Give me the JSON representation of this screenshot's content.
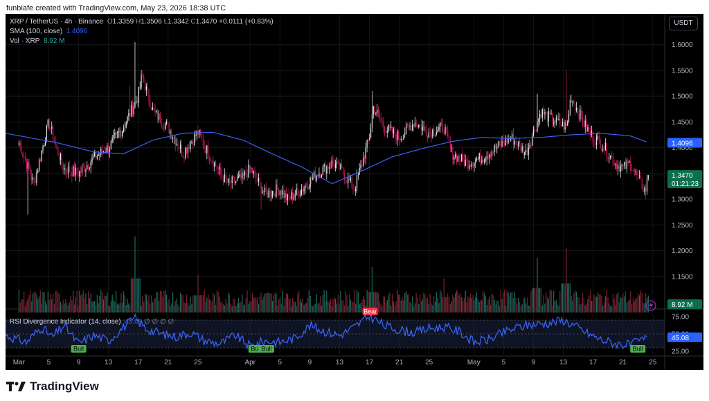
{
  "header": {
    "credit": "funbiafe created with TradingView.com, May 23, 2026 18:38 UTC"
  },
  "legend": {
    "symbol": "XRP / TetherUS · 4h · Binance",
    "o_label": "O",
    "o": "1.3359",
    "h_label": "H",
    "h": "1.3506",
    "l_label": "L",
    "l": "1.3342",
    "c_label": "C",
    "c": "1.3470",
    "change": "+0.0111 (+0.83%)",
    "sma_label": "SMA (100, close)",
    "sma_value": "1.4096",
    "vol_label": "Vol · XRP",
    "vol_value": "8.92 M",
    "rsi_label": "RSI Divergence Indicator (14, close)",
    "rsi_value": "45.08",
    "rsi_na": "∅ ∅ ∅ ∅"
  },
  "currency_button": "USDT",
  "price_badges": {
    "sma": "1.4096",
    "last": "1.3470",
    "countdown": "01:21:23",
    "volume": "8.92 M",
    "rsi": "45.08"
  },
  "footer": {
    "brand": "TradingView",
    "logo_icon": "tradingview-logo-icon"
  },
  "colors": {
    "up": "#e8e8e8",
    "down": "#c2185b",
    "sma": "#3962f5",
    "rsi": "#3962f5",
    "vol_up": "#1e6b5f",
    "vol_down": "#7a2330",
    "bull": "#4caf50",
    "bear": "#f23645",
    "badge_sma": "#2962ff",
    "badge_last": "#0b6e4f",
    "badge_vol": "#0b6e4f"
  },
  "chart_data": [
    {
      "type": "candlestick",
      "title": "XRP / TetherUS · 4h · Binance",
      "ylim": [
        1.08,
        1.66
      ],
      "y_ticks": [
        1.6,
        1.55,
        1.5,
        1.45,
        1.4,
        1.35,
        1.3,
        1.25,
        1.2,
        1.15
      ],
      "x_ticks": [
        "Mar",
        "5",
        "9",
        "13",
        "17",
        "21",
        "25",
        "Apr",
        "5",
        "9",
        "13",
        "17",
        "21",
        "25",
        "May",
        "5",
        "9",
        "13",
        "17",
        "21",
        "25"
      ],
      "x_tick_days": [
        0,
        4,
        8,
        12,
        16,
        20,
        24,
        31,
        35,
        39,
        43,
        47,
        51,
        55,
        61,
        65,
        69,
        73,
        77,
        81,
        85
      ],
      "x_domain_days": [
        -1.8,
        86.6
      ],
      "close_anchor_days": [
        0,
        2,
        4,
        5,
        6,
        8,
        10,
        12,
        14,
        16,
        16.5,
        18,
        20,
        22,
        24,
        25,
        27,
        28,
        30,
        31,
        33,
        35,
        36,
        38,
        40,
        42,
        43,
        45,
        47,
        47.5,
        49,
        51,
        53,
        55,
        57,
        58,
        60,
        62,
        64,
        66,
        68,
        69,
        70,
        71,
        72,
        73.5,
        74,
        75,
        76,
        77,
        78,
        79,
        80,
        81,
        82,
        83,
        84,
        84.4
      ],
      "close_anchors": [
        1.41,
        1.33,
        1.45,
        1.4,
        1.36,
        1.35,
        1.38,
        1.4,
        1.44,
        1.5,
        1.54,
        1.47,
        1.44,
        1.39,
        1.43,
        1.4,
        1.35,
        1.33,
        1.34,
        1.36,
        1.31,
        1.32,
        1.3,
        1.32,
        1.35,
        1.37,
        1.36,
        1.32,
        1.42,
        1.48,
        1.44,
        1.42,
        1.45,
        1.43,
        1.44,
        1.39,
        1.37,
        1.38,
        1.4,
        1.42,
        1.39,
        1.43,
        1.47,
        1.46,
        1.45,
        1.44,
        1.5,
        1.47,
        1.44,
        1.42,
        1.41,
        1.39,
        1.37,
        1.36,
        1.37,
        1.34,
        1.315,
        1.347
      ],
      "spikes": [
        {
          "day": 15.6,
          "high": 1.605
        },
        {
          "day": 14.9,
          "high": 1.52
        },
        {
          "day": 47.4,
          "high": 1.51
        },
        {
          "day": 73.4,
          "high": 1.55
        },
        {
          "day": 69.5,
          "high": 1.505
        },
        {
          "day": 1.2,
          "low": 1.27
        },
        {
          "day": 32.5,
          "low": 1.28
        },
        {
          "day": 84.0,
          "low": 1.3
        }
      ],
      "sma_anchor_days": [
        -1.8,
        5,
        10,
        14,
        18,
        22,
        26,
        30,
        34,
        38,
        42,
        46,
        50,
        54,
        58,
        62,
        66,
        70,
        74,
        78,
        82,
        84.4
      ],
      "sma_anchors": [
        1.428,
        1.41,
        1.392,
        1.388,
        1.415,
        1.428,
        1.43,
        1.415,
        1.388,
        1.362,
        1.33,
        1.355,
        1.382,
        1.398,
        1.412,
        1.42,
        1.418,
        1.42,
        1.425,
        1.428,
        1.423,
        1.41
      ],
      "last_close": 1.347,
      "sma_last": 1.4096
    },
    {
      "type": "bar",
      "title": "Vol · XRP",
      "last_value_m": 8.92,
      "spike_days": [
        15.6,
        47.4,
        73.4,
        69.5,
        24,
        57
      ],
      "spike_rel": [
        1.0,
        0.6,
        0.85,
        0.72,
        0.5,
        0.45
      ]
    },
    {
      "type": "line",
      "title": "RSI Divergence Indicator (14, close)",
      "ylim": [
        20,
        82
      ],
      "y_ticks": [
        75,
        50,
        25
      ],
      "band": [
        30,
        70
      ],
      "midline": 50,
      "rsi_anchor_days": [
        -1.8,
        1,
        3,
        4.5,
        6,
        8,
        10,
        12,
        14,
        15.6,
        17,
        19,
        21,
        23,
        25,
        27,
        29,
        31,
        33,
        35,
        37,
        39,
        41,
        43,
        45,
        47,
        49,
        51,
        53,
        55,
        57,
        59,
        61,
        63,
        65,
        67,
        69,
        71,
        73,
        74.5,
        76,
        78,
        80,
        82,
        84.4
      ],
      "rsi_anchors": [
        48,
        38,
        60,
        45,
        62,
        36,
        48,
        40,
        60,
        72,
        58,
        50,
        46,
        52,
        40,
        36,
        48,
        32,
        40,
        38,
        44,
        62,
        54,
        48,
        60,
        76,
        62,
        56,
        52,
        58,
        60,
        54,
        38,
        42,
        52,
        60,
        64,
        66,
        70,
        62,
        52,
        42,
        36,
        34,
        45.08
      ],
      "last_value": 45.08,
      "labels": [
        {
          "text": "Bull",
          "day": 8.0,
          "kind": "bull"
        },
        {
          "text": "Bull",
          "day": 31.8,
          "kind": "bull"
        },
        {
          "text": "Bull",
          "day": 33.2,
          "kind": "bull"
        },
        {
          "text": "Bear",
          "day": 47.1,
          "kind": "bear"
        },
        {
          "text": "Bull",
          "day": 83.0,
          "kind": "bull"
        }
      ]
    }
  ]
}
